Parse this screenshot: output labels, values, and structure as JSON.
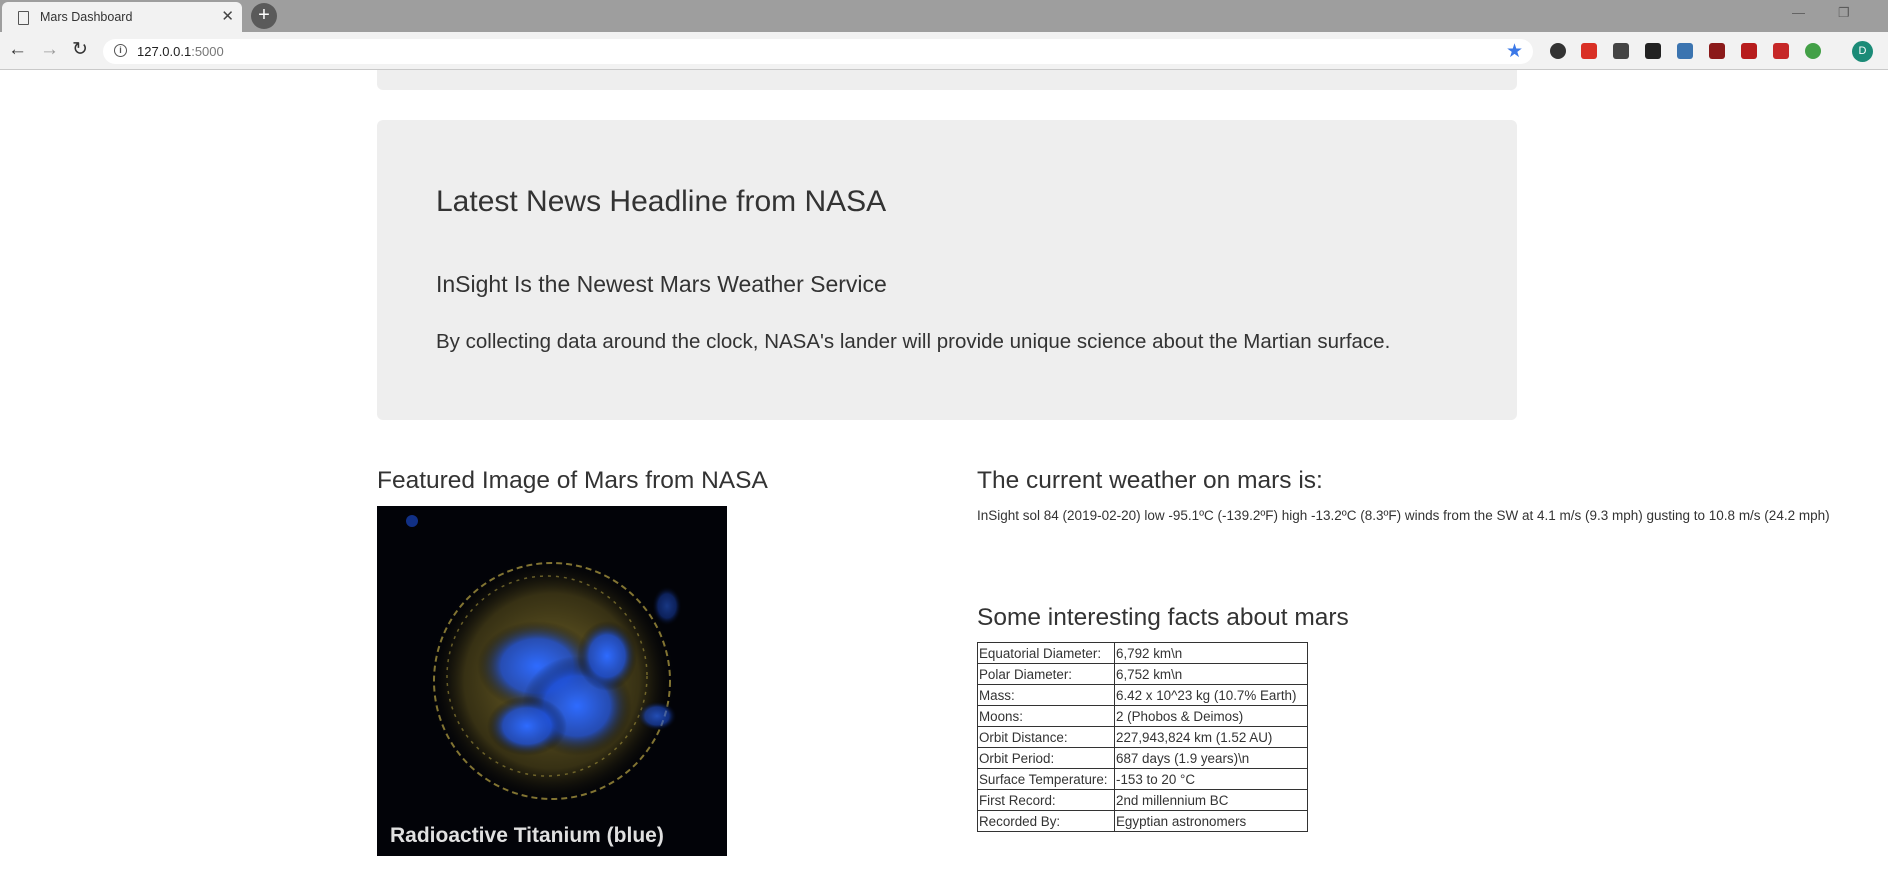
{
  "browser": {
    "tab_title": "Mars Dashboard",
    "tab_close": "✕",
    "new_tab": "+",
    "url_host": "127.0.0.1",
    "url_port": ":5000",
    "avatar_initial": "D",
    "accent_star_color": "#3b78e7"
  },
  "news": {
    "heading": "Latest News Headline from NASA",
    "title": "InSight Is the Newest Mars Weather Service",
    "teaser": "By collecting data around the clock, NASA's lander will provide unique science about the Martian surface."
  },
  "featured_image": {
    "heading": "Featured Image of Mars from NASA",
    "caption": "Radioactive Titanium (blue)"
  },
  "weather": {
    "heading": "The current weather on mars is:",
    "text": "InSight sol 84 (2019-02-20) low -95.1ºC (-139.2ºF) high -13.2ºC (8.3ºF) winds from the SW at 4.1 m/s (9.3 mph) gusting to 10.8 m/s (24.2 mph)"
  },
  "facts": {
    "heading": "Some interesting facts about mars",
    "rows": [
      {
        "label": "Equatorial Diameter:",
        "value": "6,792 km\\n"
      },
      {
        "label": "Polar Diameter:",
        "value": "6,752 km\\n"
      },
      {
        "label": "Mass:",
        "value": "6.42 x 10^23 kg (10.7% Earth)"
      },
      {
        "label": "Moons:",
        "value": "2 (Phobos & Deimos)"
      },
      {
        "label": "Orbit Distance:",
        "value": "227,943,824 km (1.52 AU)"
      },
      {
        "label": "Orbit Period:",
        "value": "687 days (1.9 years)\\n"
      },
      {
        "label": "Surface Temperature:",
        "value": "-153 to 20 °C"
      },
      {
        "label": "First Record:",
        "value": "2nd millennium BC"
      },
      {
        "label": "Recorded By:",
        "value": "Egyptian astronomers"
      }
    ]
  }
}
